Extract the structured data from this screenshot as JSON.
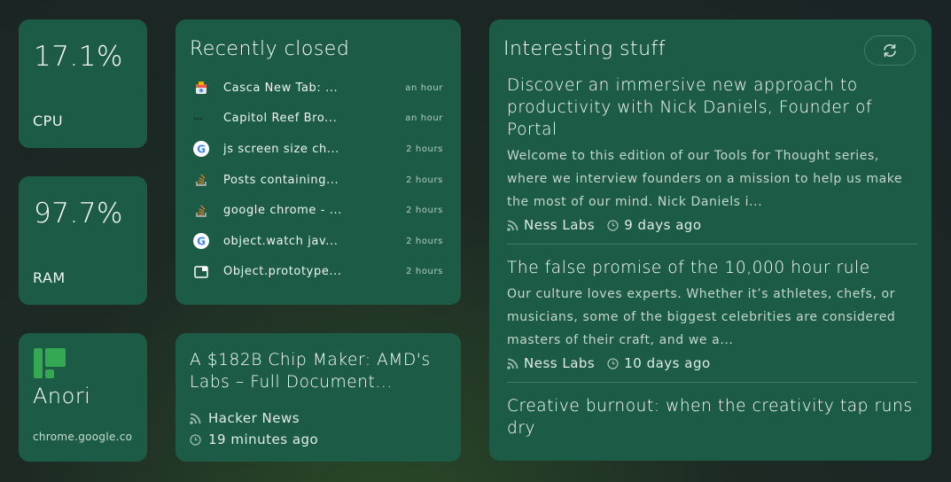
{
  "cpu": {
    "value": "17.1%",
    "label": "CPU"
  },
  "ram": {
    "value": "97.7%",
    "label": "RAM"
  },
  "app": {
    "name": "Anori",
    "url": "chrome.google.co"
  },
  "recent": {
    "title": "Recently closed",
    "items": [
      {
        "title": "Casca New Tab: ...",
        "time": "an hour",
        "icon": "casca-favicon"
      },
      {
        "title": "Capitol Reef Bro...",
        "time": "an hour",
        "icon": "nps-favicon"
      },
      {
        "title": "js screen size ch...",
        "time": "2 hours",
        "icon": "google-favicon"
      },
      {
        "title": "Posts containing...",
        "time": "2 hours",
        "icon": "stackoverflow-favicon"
      },
      {
        "title": "google chrome - ...",
        "time": "2 hours",
        "icon": "stackoverflow-favicon"
      },
      {
        "title": "object.watch jav...",
        "time": "2 hours",
        "icon": "google-favicon"
      },
      {
        "title": "Object.prototype...",
        "time": "2 hours",
        "icon": "window-icon"
      }
    ]
  },
  "hn": {
    "title": "A $182B Chip Maker: AMD's Labs – Full Document...",
    "source": "Hacker News",
    "time": "19 minutes ago"
  },
  "feed": {
    "title": "Interesting stuff",
    "refresh_icon": "refresh-icon",
    "articles": [
      {
        "title": "Discover an immersive new approach to productivity with Nick Daniels, Founder of Portal",
        "desc": "Welcome to this edition of our Tools for Thought series, where we interview founders on a mission to help us make the most of our mind. Nick Daniels i...",
        "source": "Ness Labs",
        "time": "9 days ago"
      },
      {
        "title": "The false promise of the 10,000 hour rule",
        "desc": "Our culture loves experts. Whether it’s athletes, chefs, or musicians, some of the biggest celebrities are considered masters of their craft, and we a...",
        "source": "Ness Labs",
        "time": "10 days ago"
      },
      {
        "title": "Creative burnout: when the creativity tap runs dry",
        "desc": "",
        "source": "",
        "time": ""
      }
    ]
  },
  "colors": {
    "card": "#1c5c46",
    "background": "#1a2326",
    "accent": "#34a853"
  }
}
